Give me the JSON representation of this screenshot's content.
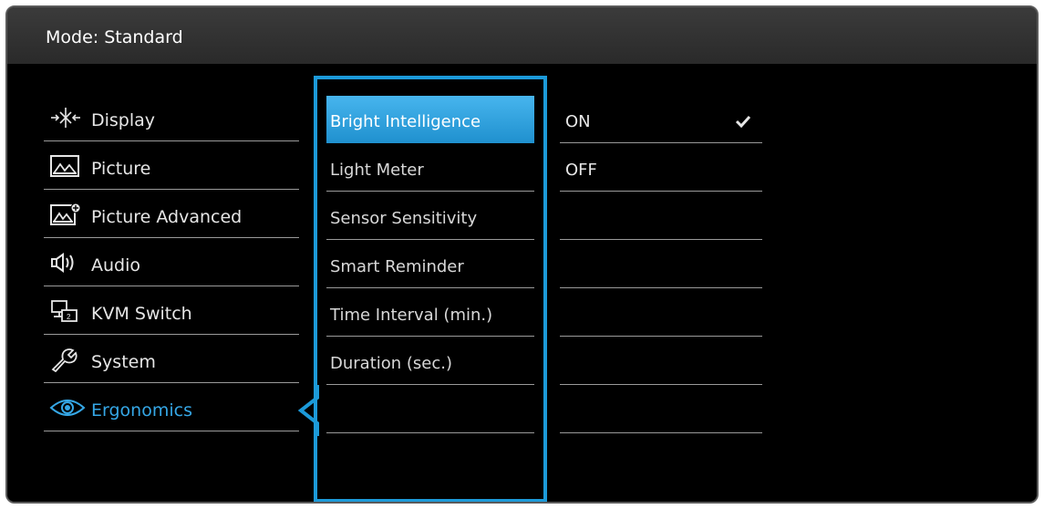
{
  "title_bar": {
    "mode_text": "Mode: Standard"
  },
  "menu": {
    "items": [
      {
        "label": "Display",
        "icon": "display-icon"
      },
      {
        "label": "Picture",
        "icon": "picture-icon"
      },
      {
        "label": "Picture Advanced",
        "icon": "picture-advanced-icon"
      },
      {
        "label": "Audio",
        "icon": "audio-icon"
      },
      {
        "label": "KVM Switch",
        "icon": "kvm-switch-icon"
      },
      {
        "label": "System",
        "icon": "system-icon"
      },
      {
        "label": "Ergonomics",
        "icon": "ergonomics-icon",
        "active": true
      }
    ]
  },
  "submenu": {
    "items": [
      {
        "label": "Bright Intelligence",
        "selected": true
      },
      {
        "label": "Light Meter"
      },
      {
        "label": "Sensor Sensitivity"
      },
      {
        "label": "Smart Reminder"
      },
      {
        "label": "Time Interval (min.)"
      },
      {
        "label": "Duration (sec.)"
      },
      {
        "label": ""
      }
    ]
  },
  "options": {
    "items": [
      {
        "label": "ON",
        "checked": true
      },
      {
        "label": "OFF"
      },
      {
        "label": ""
      },
      {
        "label": ""
      },
      {
        "label": ""
      },
      {
        "label": ""
      },
      {
        "label": ""
      }
    ]
  },
  "colors": {
    "accent": "#1c9ad9",
    "highlight": "#35a7e6",
    "background": "#000000",
    "text": "#e6e6e6"
  }
}
